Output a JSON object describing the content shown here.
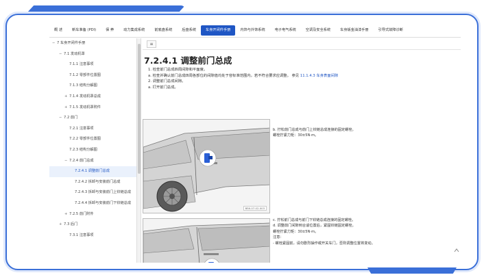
{
  "topnav": {
    "tabs": [
      {
        "label": "概 述",
        "active": false
      },
      {
        "label": "新车准备 (PDI)",
        "active": false
      },
      {
        "label": "保 养",
        "active": false
      },
      {
        "label": "动力集成系统",
        "active": false
      },
      {
        "label": "前底盘系统",
        "active": false
      },
      {
        "label": "后盘系统",
        "active": false
      },
      {
        "label": "车身开闭件手册",
        "active": true
      },
      {
        "label": "内饰与外饰系统",
        "active": false
      },
      {
        "label": "电子电气系统",
        "active": false
      },
      {
        "label": "空调及安全系统",
        "active": false
      },
      {
        "label": "车身钣金油漆手册",
        "active": false
      },
      {
        "label": "引导式故障诊断",
        "active": false
      }
    ]
  },
  "sidebar": {
    "items": [
      {
        "toggle": "−",
        "label": "7 车身开闭件手册",
        "level": 0
      },
      {
        "toggle": "−",
        "label": "7.1 发动机罩",
        "level": 1
      },
      {
        "toggle": "",
        "label": "7.1.1 注意事项",
        "level": 2
      },
      {
        "toggle": "",
        "label": "7.1.2 零部件位置图",
        "level": 2
      },
      {
        "toggle": "",
        "label": "7.1.3 结构分解图",
        "level": 2
      },
      {
        "toggle": "+",
        "label": "7.1.4 发动机罩总成",
        "level": 2
      },
      {
        "toggle": "+",
        "label": "7.1.5 发动机罩附件",
        "level": 2
      },
      {
        "toggle": "−",
        "label": "7.2 前门",
        "level": 1
      },
      {
        "toggle": "",
        "label": "7.2.1 注意事项",
        "level": 2
      },
      {
        "toggle": "",
        "label": "7.2.2 零部件位置图",
        "level": 2
      },
      {
        "toggle": "",
        "label": "7.2.3 结构分解图",
        "level": 2
      },
      {
        "toggle": "−",
        "label": "7.2.4 前门总成",
        "level": 2
      },
      {
        "toggle": "",
        "label": "7.2.4.1 调整前门总成",
        "level": 3,
        "selected": true
      },
      {
        "toggle": "",
        "label": "7.2.4.2 拆卸与安装前门总成",
        "level": 3
      },
      {
        "toggle": "",
        "label": "7.2.4.3 拆卸与安装前门上铰链总成",
        "level": 3
      },
      {
        "toggle": "",
        "label": "7.2.4.4 拆卸与安装前门下铰链总成",
        "level": 3
      },
      {
        "toggle": "+",
        "label": "7.2.5 前门附件",
        "level": 2
      },
      {
        "toggle": "+",
        "label": "7.3 后门",
        "level": 1
      },
      {
        "toggle": "",
        "label": "7.3.1 注意事项",
        "level": 2
      }
    ]
  },
  "content": {
    "menu_icon": "≡",
    "title": "7.2.4.1 调整前门总成",
    "steps": [
      {
        "text": "1. 检查前门总成四周间隙和平面度。",
        "ref": ""
      },
      {
        "text": "a. 检查并确认前门总成四周各部位的间隙值均处于容标准范围内，若不符合要求应调整。 参见 ",
        "ref": "11.1.4.3 车身表面间隙"
      },
      {
        "text": "2. 调整前门总成间隙。",
        "ref": ""
      },
      {
        "text": "a. 打开前门总成。",
        "ref": ""
      }
    ],
    "figure1": {
      "code": "BS6-07-02-003"
    },
    "desc1": [
      "b. 拧松前门总成与前门上铰链总成连接的固定螺栓。",
      "螺栓拧紧力矩：30±5N·m。"
    ],
    "desc2": [
      "c. 拧松前门总成与前门下铰链总成连接的固定螺栓。",
      "d. 调整前门间隙到合适位置后，紧固铰链固定螺栓。",
      "螺栓拧紧力矩：30±5N·m。",
      "注意：",
      "- 螺栓紧固前，请勿剧烈操作或开关车门，否则调整位置将变动。"
    ]
  },
  "colors": {
    "accent": "#1f56c4",
    "frame": "#3a6fd8"
  },
  "icons": {
    "scroll_up": "chevron-up-icon",
    "menu": "menu-icon"
  }
}
